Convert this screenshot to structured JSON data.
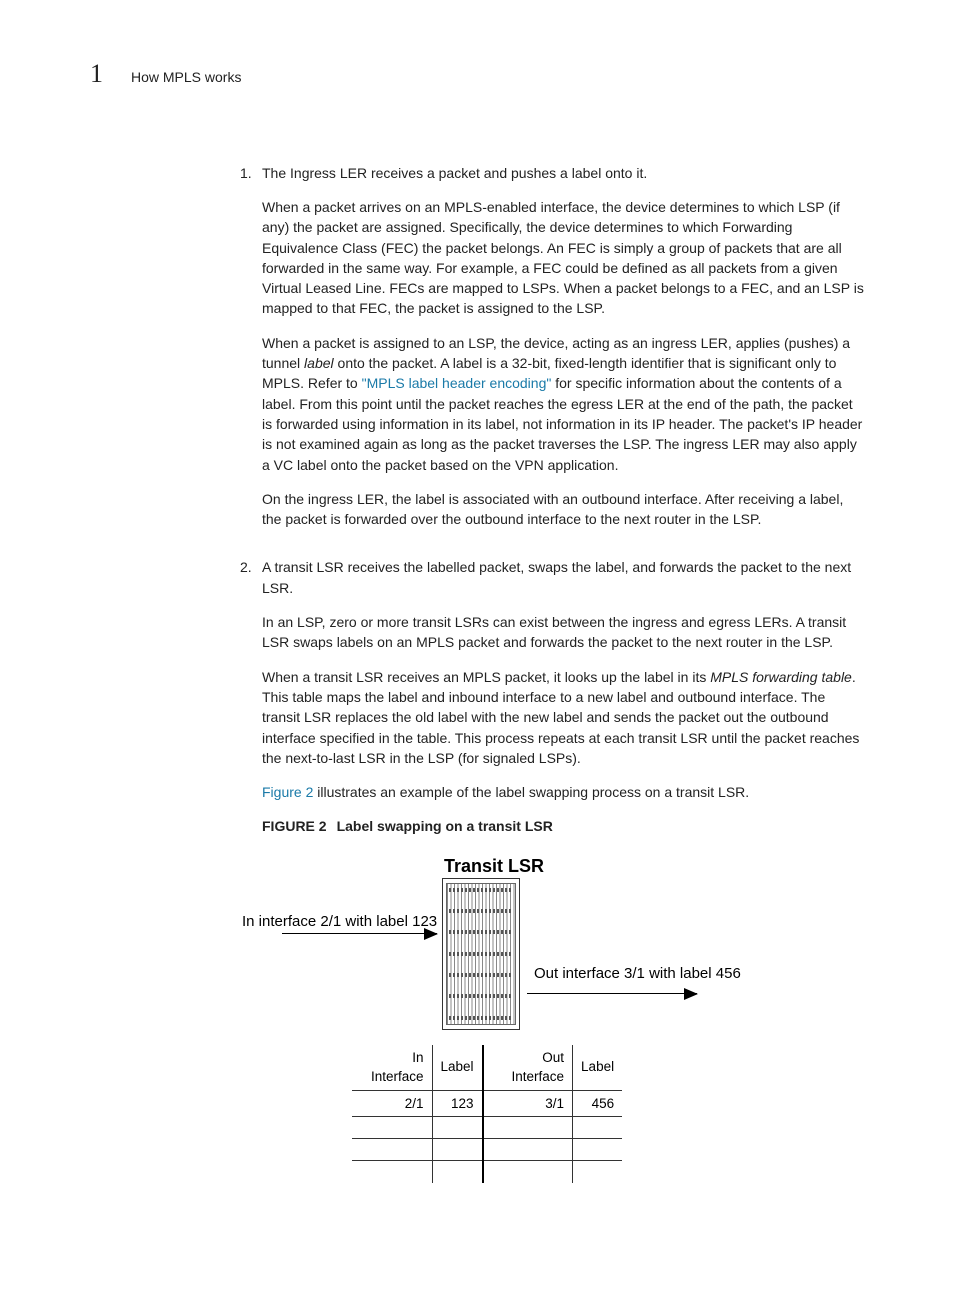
{
  "header": {
    "chapter_number": "1",
    "chapter_title": "How MPLS works"
  },
  "steps": [
    {
      "num": "1.",
      "lead": "The Ingress LER receives a packet and pushes a label onto it.",
      "paras": [
        "When a packet arrives on an MPLS-enabled interface, the device determines to which LSP (if any) the packet are assigned. Specifically, the device determines to which Forwarding Equivalence Class (FEC) the packet belongs. An FEC is simply a group of packets that are all forwarded in the same way. For example, a FEC could be defined as all packets from a given Virtual Leased Line. FECs are mapped to LSPs. When a packet belongs to a FEC, and an LSP is mapped to that FEC, the packet is assigned to the LSP."
      ],
      "p2a": "When a packet is assigned to an LSP, the device, acting as an ingress LER, applies (pushes) a tunnel ",
      "p2_italic": "label",
      "p2b": " onto the packet. A label is a 32-bit, fixed-length identifier that is significant only to MPLS. Refer to ",
      "p2_link": "\"MPLS label header encoding\"",
      "p2c": " for specific information about the contents of a label. From this point until the packet reaches the egress LER at the end of the path, the packet is forwarded using information in its label, not information in its IP header. The packet's IP header is not examined again as long as the packet traverses the LSP. The ingress LER may also apply a VC label onto the packet based on the VPN application.",
      "p3": "On the ingress LER, the label is associated with an outbound interface. After receiving a label, the packet is forwarded over the outbound interface to the next router in the LSP."
    },
    {
      "num": "2.",
      "lead": "A transit LSR receives the labelled packet, swaps the label, and forwards the packet to the next LSR.",
      "paras": [
        "In an LSP, zero or more transit LSRs can exist between the ingress and egress LERs. A transit LSR swaps labels on an MPLS packet and forwards the packet to the next router in the LSP."
      ],
      "p4a": "When a transit LSR receives an MPLS packet, it looks up the label in its ",
      "p4_italic": "MPLS forwarding table",
      "p4b": ". This table maps the label and inbound interface to a new label and outbound interface. The transit LSR replaces the old label with the new label and sends the packet out the outbound interface specified in the table. This process repeats at each transit LSR until the packet reaches the next-to-last LSR in the LSP (for signaled LSPs).",
      "p5_link": "Figure 2",
      "p5_rest": " illustrates an example of the label swapping process on a transit LSR."
    }
  ],
  "figure": {
    "label": "FIGURE 2",
    "caption": "Label swapping on a transit LSR",
    "title": "Transit LSR",
    "in_text": "In interface 2/1 with label 123",
    "out_text": "Out interface 3/1 with label 456",
    "table": {
      "headers": [
        "In Interface",
        "Label",
        "Out Interface",
        "Label"
      ],
      "row": [
        "2/1",
        "123",
        "3/1",
        "456"
      ]
    }
  }
}
